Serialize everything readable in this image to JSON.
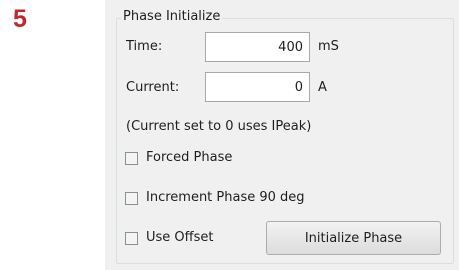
{
  "step_number": "5",
  "group": {
    "title": "Phase Initialize",
    "time": {
      "label": "Time:",
      "value": "400",
      "unit": "mS"
    },
    "current": {
      "label": "Current:",
      "value": "0",
      "unit": "A"
    },
    "note": "(Current set to 0 uses IPeak)",
    "checkboxes": {
      "forced_phase": {
        "label": "Forced Phase",
        "checked": false
      },
      "increment_phase": {
        "label": "Increment Phase 90 deg",
        "checked": false
      },
      "use_offset": {
        "label": "Use Offset",
        "checked": false
      }
    },
    "initialize_button": "Initialize Phase"
  }
}
